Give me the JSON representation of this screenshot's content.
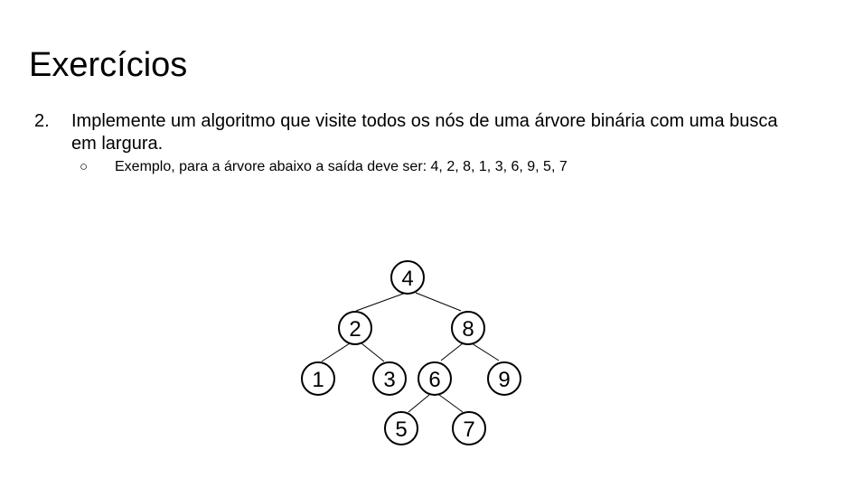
{
  "slide": {
    "title": "Exercícios"
  },
  "exercise": {
    "number": "2.",
    "text": "Implemente um algoritmo que visite todos os nós de uma árvore binária com uma busca em largura.",
    "sub_bullet": "○",
    "example_text": "Exemplo, para a árvore abaixo a saída deve ser: 4, 2, 8, 1, 3, 6, 9, 5, 7"
  },
  "tree": {
    "nodes": [
      "4",
      "2",
      "8",
      "1",
      "3",
      "6",
      "9",
      "5",
      "7"
    ],
    "edges": [
      [
        "4",
        "2"
      ],
      [
        "4",
        "8"
      ],
      [
        "2",
        "1"
      ],
      [
        "2",
        "3"
      ],
      [
        "8",
        "6"
      ],
      [
        "8",
        "9"
      ],
      [
        "6",
        "5"
      ],
      [
        "6",
        "7"
      ]
    ]
  }
}
